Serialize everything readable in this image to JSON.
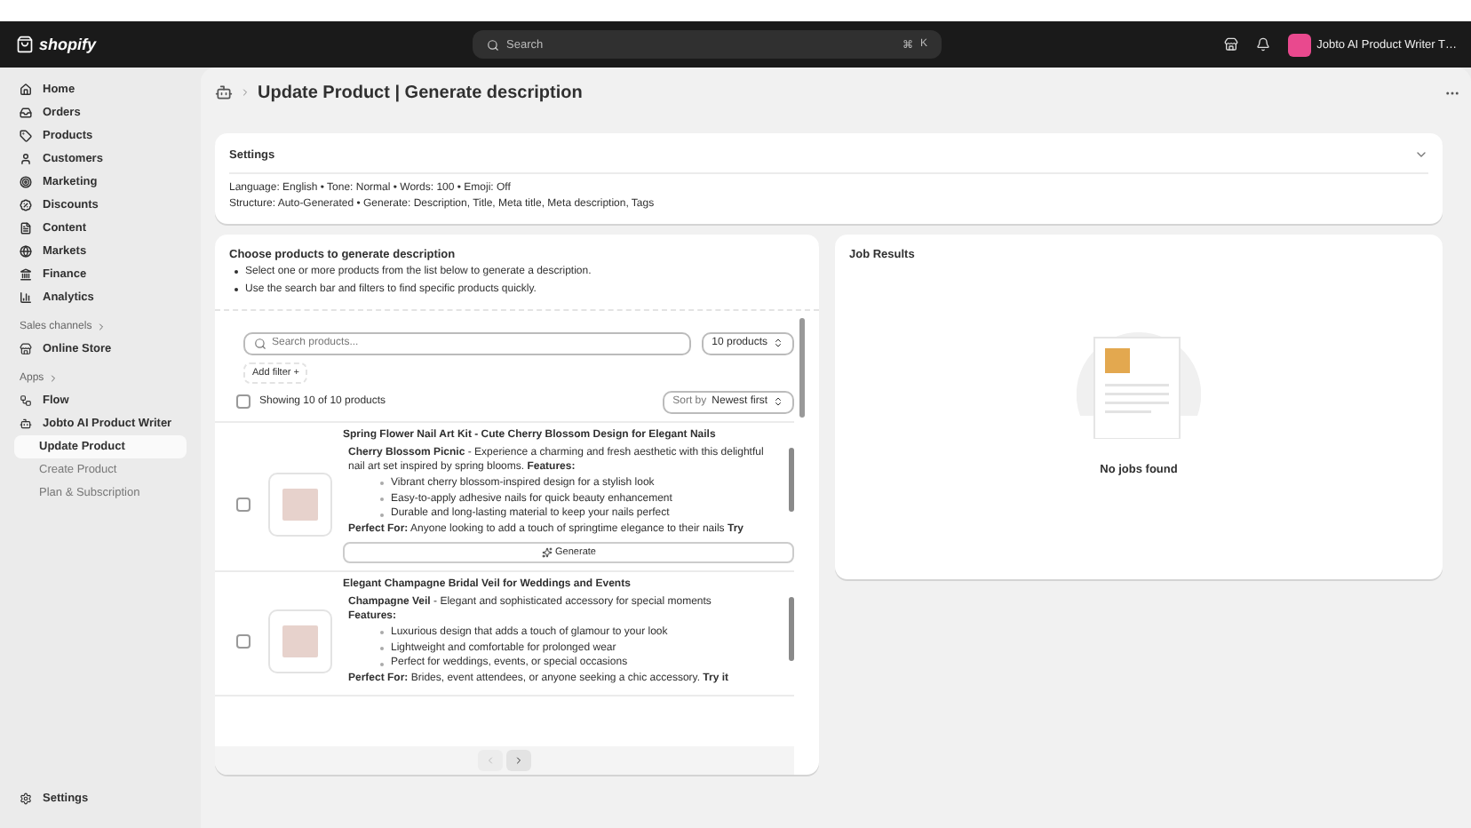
{
  "topbar": {
    "brand": "shopify",
    "search": {
      "placeholder": "Search",
      "shortcut": [
        "⌘",
        "K"
      ]
    },
    "store": "Jobto AI Product Writer T…"
  },
  "sidebar": {
    "items": [
      {
        "label": "Home",
        "selected": false
      },
      {
        "label": "Orders",
        "selected": false
      },
      {
        "label": "Products",
        "selected": false
      },
      {
        "label": "Customers",
        "selected": false
      },
      {
        "label": "Marketing",
        "selected": false
      },
      {
        "label": "Discounts",
        "selected": false
      },
      {
        "label": "Content",
        "selected": false
      },
      {
        "label": "Markets",
        "selected": false
      },
      {
        "label": "Finance",
        "selected": false
      },
      {
        "label": "Analytics",
        "selected": false
      }
    ],
    "sections": [
      {
        "title": "Sales channels",
        "items": [
          {
            "label": "Online Store"
          }
        ]
      },
      {
        "title": "Apps",
        "items": [
          {
            "label": "Flow"
          },
          {
            "label": "Jobto AI Product Writer",
            "children": [
              {
                "label": "Update Product",
                "selected": true
              },
              {
                "label": "Create Product",
                "selected": false
              },
              {
                "label": "Plan & Subscription",
                "selected": false
              }
            ]
          }
        ]
      }
    ],
    "footer": "Settings"
  },
  "page": {
    "title": "Update Product | Generate description"
  },
  "settings": {
    "title": "Settings",
    "expanded": false,
    "lines": [
      "Language: English • Tone: Normal • Words: 100 • Emoji: Off",
      "Structure: Auto-Generated • Generate: Description, Title, Meta title, Meta description, Tags"
    ]
  },
  "chooser": {
    "title": "Choose products to generate description",
    "tips": [
      "Select one or more products from the list below to generate a description.",
      "Use the search bar and filters to find specific products quickly."
    ],
    "search": {
      "placeholder": "Search products..."
    },
    "count_select": "10 products",
    "add_filter": "Add filter +",
    "select_all": {
      "label": "Showing 10 of 10 products",
      "checked": false
    },
    "sort": {
      "label": "Sort by",
      "value": "Newest first"
    },
    "products": [
      {
        "title": "Spring Flower Nail Art Kit - Cute Cherry Blossom Design for Elegant Nails",
        "checked": false,
        "intro": "**Cherry Blossom Picnic** - Experience a charming and fresh aesthetic with this delightful nail art set inspired by spring blooms. **Features:**",
        "bullets": [
          "Vibrant cherry blossom-inspired design for a stylish look",
          "Easy-to-apply adhesive nails for quick beauty enhancement",
          "Durable and long-lasting material to keep your nails perfect"
        ],
        "outro": "**Perfect For:** Anyone looking to add a touch of springtime elegance to their nails **Try**",
        "button": "Generate"
      },
      {
        "title": "Elegant Champagne Bridal Veil for Weddings and Events",
        "checked": false,
        "intro": "**Champagne Veil** - Elegant and sophisticated accessory for special moments",
        "heading": "Features:",
        "bullets": [
          "Luxurious design that adds a touch of glamour to your look",
          "Lightweight and comfortable for prolonged wear",
          "Perfect for weddings, events, or special occasions"
        ],
        "outro": "**Perfect For:** Brides, event attendees, or anyone seeking a chic accessory. **Try it**"
      }
    ],
    "pagination": {
      "previous_disabled": true,
      "next_disabled": false
    }
  },
  "results": {
    "title": "Job Results",
    "empty": "No jobs found"
  }
}
